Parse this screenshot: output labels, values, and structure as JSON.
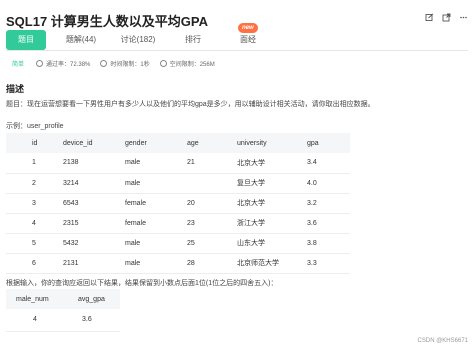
{
  "header": {
    "title": "SQL17  计算男生人数以及平均GPA",
    "icons": [
      "edit-icon",
      "share-icon",
      "more-icon"
    ]
  },
  "tabs": [
    {
      "label": "题目",
      "active": true
    },
    {
      "label": "题解(44)"
    },
    {
      "label": "讨论(182)"
    },
    {
      "label": "排行"
    },
    {
      "label": "面经",
      "badge": "new"
    }
  ],
  "meta": {
    "difficulty": "简单",
    "pass_rate": "通过率：72.38%",
    "time_limit": "时间限制：1秒",
    "memory_limit": "空间限制：256M"
  },
  "section_title": "描述",
  "description": "题目：现在运营想要看一下男性用户有多少人以及他们的平均gpa是多少，用以辅助设计相关活动，请你取出相应数据。",
  "example_label": "示例：user_profile",
  "table": {
    "headers": [
      "id",
      "device_id",
      "gender",
      "age",
      "university",
      "gpa"
    ],
    "rows": [
      [
        "1",
        "2138",
        "male",
        "21",
        "北京大学",
        "3.4"
      ],
      [
        "2",
        "3214",
        "male",
        "",
        "复旦大学",
        "4.0"
      ],
      [
        "3",
        "6543",
        "female",
        "20",
        "北京大学",
        "3.2"
      ],
      [
        "4",
        "2315",
        "female",
        "23",
        "浙江大学",
        "3.6"
      ],
      [
        "5",
        "5432",
        "male",
        "25",
        "山东大学",
        "3.8"
      ],
      [
        "6",
        "2131",
        "male",
        "28",
        "北京师范大学",
        "3.3"
      ]
    ]
  },
  "result_desc": "根据输入，你的查询应返回以下结果，结果保留到小数点后面1位(1位之后的四舍五入)：",
  "result_table": {
    "headers": [
      "male_num",
      "avg_gpa"
    ],
    "rows": [
      [
        "4",
        "3.6"
      ]
    ]
  },
  "watermark": "CSDN @KHS6671",
  "colors": {
    "accent": "#32ca99",
    "badge": "#ff7043"
  }
}
